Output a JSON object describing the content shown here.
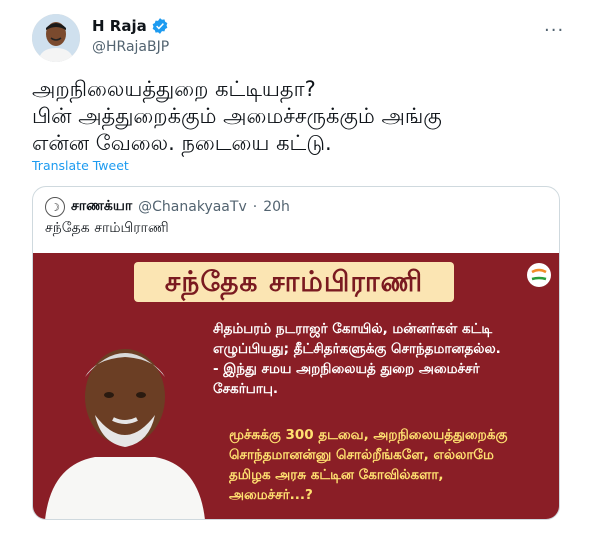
{
  "author": {
    "name": "H Raja",
    "handle": "@HRajaBJP",
    "verified": true
  },
  "more_icon": "more-icon",
  "tweet": {
    "lines": [
      "அறநிலையத்துறை கட்டியதா?",
      "பின் அத்துறைக்கும் அமைச்சருக்கும் அங்கு",
      "என்ன வேலை. நடையை கட்டு."
    ],
    "translate_label": "Translate Tweet"
  },
  "quoted_tweet": {
    "name": "சாணக்யா",
    "handle": "@ChanakyaaTv",
    "separator": "·",
    "time": "20h",
    "text": "சந்தேக சாம்பிராணி",
    "media": {
      "title": "சந்தேக சாம்பிராணி",
      "quote_lines": [
        "சிதம்பரம் நடராஜர் கோயில், மன்னர்கள் கட்டி",
        "எழுப்பியது; தீட்சிதர்களுக்கு சொந்தமானதல்ல.",
        "- இந்து சமய அறநிலையத் துறை அமைச்சர்",
        "சேகர்பாபு."
      ],
      "reply_lines": [
        "மூச்சுக்கு 300 தடவை, அறநிலையத்துறைக்கு",
        "சொந்தமானன்னு சொல்றீங்களே, எல்லாமே",
        "தமிழக அரசு கட்டின கோவில்களா,",
        "அமைச்சர்...?"
      ]
    }
  },
  "colors": {
    "link": "#1d9bf0",
    "media_background": "#8a1e26",
    "title_banner": "#fbe5b3",
    "reply_text": "#ffe070"
  }
}
